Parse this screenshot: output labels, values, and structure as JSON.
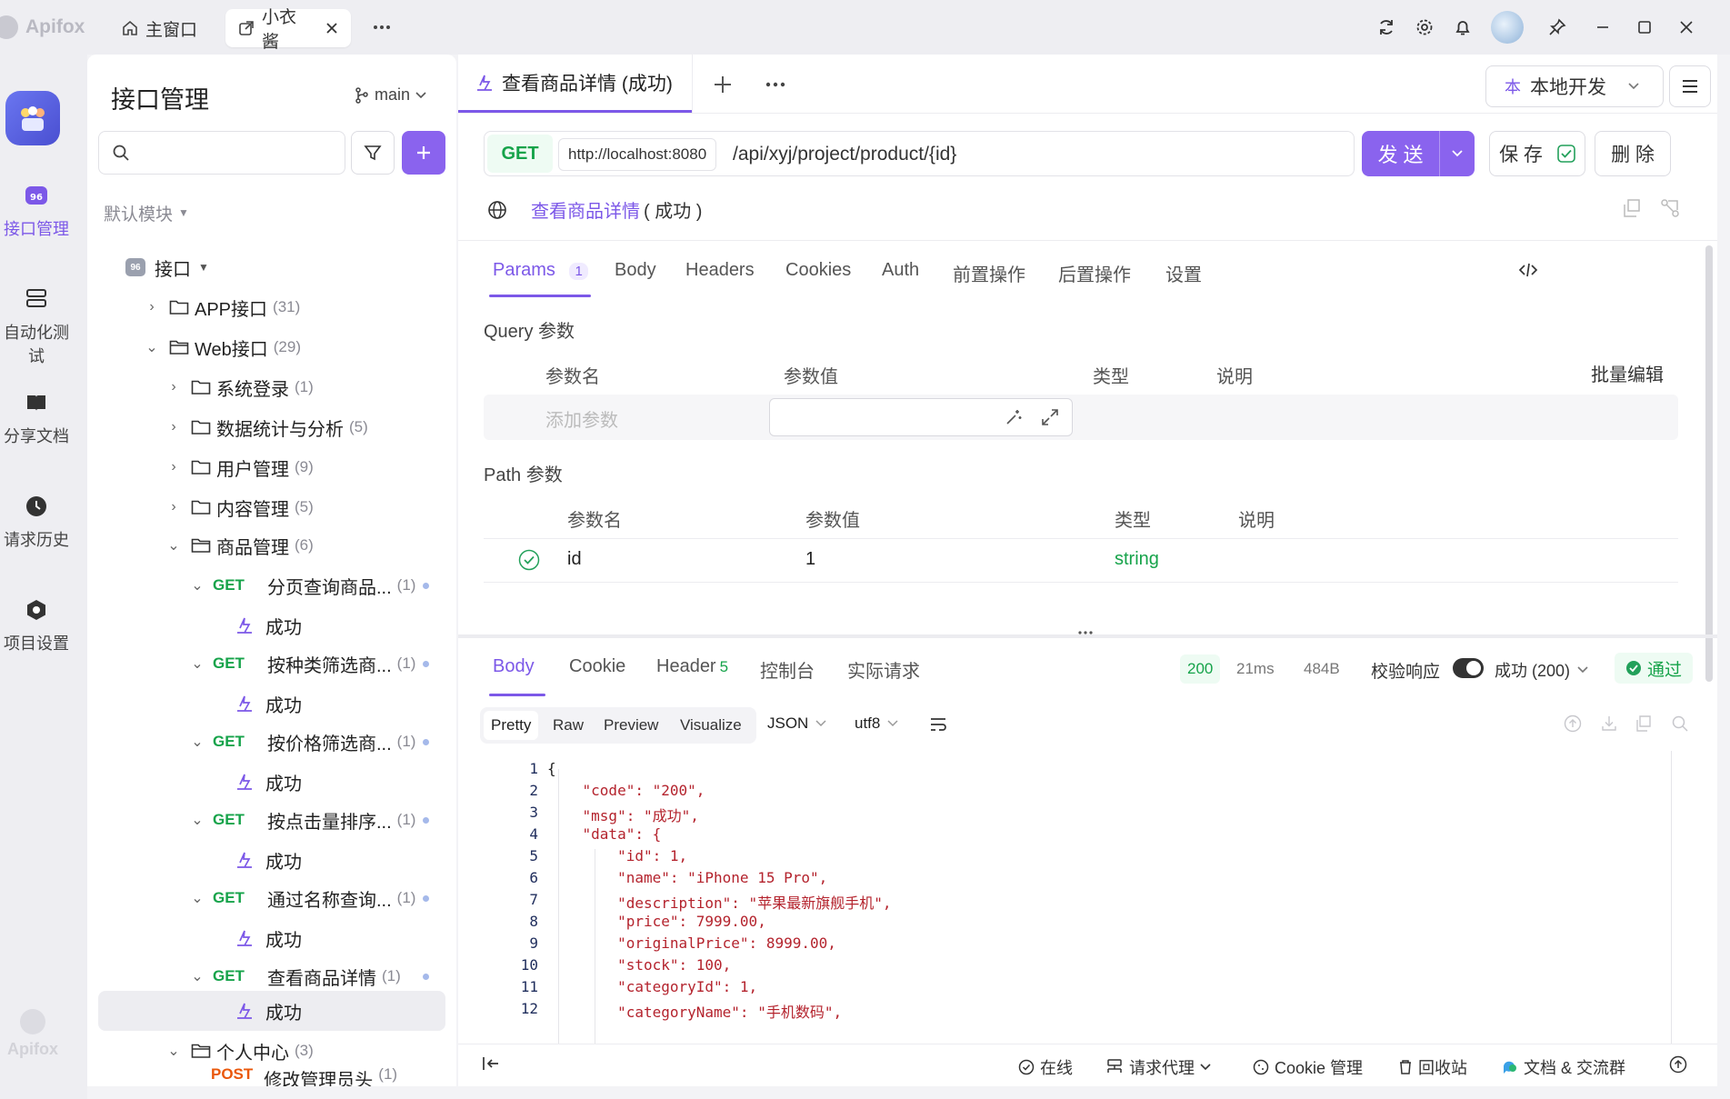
{
  "app": {
    "name": "Apifox",
    "tabs": [
      {
        "label": "主窗口"
      },
      {
        "label": "小衣酱"
      }
    ]
  },
  "rail": {
    "items": [
      {
        "label": "接口管理"
      },
      {
        "label": "自动化测试"
      },
      {
        "label": "分享文档"
      },
      {
        "label": "请求历史"
      },
      {
        "label": "项目设置"
      }
    ],
    "footer_logo": "Apifox"
  },
  "tree": {
    "title": "接口管理",
    "branch": "main",
    "search_placeholder": "",
    "module": "默认模块",
    "root": "接口",
    "folders": [
      {
        "name": "APP接口",
        "count": "(31)"
      },
      {
        "name": "Web接口",
        "count": "(29)"
      },
      {
        "name": "系统登录",
        "count": "(1)"
      },
      {
        "name": "数据统计与分析",
        "count": "(5)"
      },
      {
        "name": "用户管理",
        "count": "(9)"
      },
      {
        "name": "内容管理",
        "count": "(5)"
      },
      {
        "name": "商品管理",
        "count": "(6)"
      },
      {
        "name": "个人中心",
        "count": "(3)"
      }
    ],
    "endpoints": [
      {
        "method": "GET",
        "name": "分页查询商品...",
        "count": "(1)",
        "case": "成功"
      },
      {
        "method": "GET",
        "name": "按种类筛选商...",
        "count": "(1)",
        "case": "成功"
      },
      {
        "method": "GET",
        "name": "按价格筛选商...",
        "count": "(1)",
        "case": "成功"
      },
      {
        "method": "GET",
        "name": "按点击量排序...",
        "count": "(1)",
        "case": "成功"
      },
      {
        "method": "GET",
        "name": "通过名称查询...",
        "count": "(1)",
        "case": "成功"
      },
      {
        "method": "GET",
        "name": "查看商品详情",
        "count": "(1)",
        "case": "成功"
      }
    ],
    "partial_last": {
      "method": "POST",
      "name": "修改管理员头",
      "count": "(1)"
    }
  },
  "main": {
    "tab_title": "查看商品详情 (成功)",
    "env_badge": "本",
    "env_name": "本地开发",
    "request": {
      "method": "GET",
      "base_url": "http://localhost:8080",
      "path": "/api/xyj/project/product/{id}",
      "send": "发 送",
      "save": "保 存",
      "delete": "删 除"
    },
    "breadcrumb_name": "查看商品详情",
    "breadcrumb_case": "( 成功 )",
    "subtabs": [
      "Params",
      "Body",
      "Headers",
      "Cookies",
      "Auth",
      "前置操作",
      "后置操作",
      "设置"
    ],
    "params_count": "1",
    "query": {
      "title": "Query 参数",
      "cols": [
        "参数名",
        "参数值",
        "类型",
        "说明"
      ],
      "bulk_edit": "批量编辑",
      "add_placeholder": "添加参数"
    },
    "path_params": {
      "title": "Path 参数",
      "cols": [
        "参数名",
        "参数值",
        "类型",
        "说明"
      ],
      "rows": [
        {
          "name": "id",
          "value": "1",
          "type": "string"
        }
      ]
    },
    "response": {
      "tabs": [
        "Body",
        "Cookie",
        "Header",
        "控制台",
        "实际请求"
      ],
      "header_count": "5",
      "status": "200",
      "time": "21ms",
      "size": "484B",
      "validate_label": "校验响应",
      "validate_value": "成功 (200)",
      "pass": "通过",
      "views": [
        "Pretty",
        "Raw",
        "Preview",
        "Visualize"
      ],
      "format": "JSON",
      "encoding": "utf8",
      "code": [
        {
          "n": "1",
          "t": "{"
        },
        {
          "n": "2",
          "t": "    \"code\": \"200\","
        },
        {
          "n": "3",
          "t": "    \"msg\": \"成功\","
        },
        {
          "n": "4",
          "t": "    \"data\": {"
        },
        {
          "n": "5",
          "t": "        \"id\": 1,"
        },
        {
          "n": "6",
          "t": "        \"name\": \"iPhone 15 Pro\","
        },
        {
          "n": "7",
          "t": "        \"description\": \"苹果最新旗舰手机\","
        },
        {
          "n": "8",
          "t": "        \"price\": 7999.00,"
        },
        {
          "n": "9",
          "t": "        \"originalPrice\": 8999.00,"
        },
        {
          "n": "10",
          "t": "        \"stock\": 100,"
        },
        {
          "n": "11",
          "t": "        \"categoryId\": 1,"
        },
        {
          "n": "12",
          "t": "        \"categoryName\": \"手机数码\","
        }
      ]
    },
    "statusbar": {
      "online": "在线",
      "proxy": "请求代理",
      "cookie": "Cookie 管理",
      "recycle": "回收站",
      "docs": "文档 & 交流群"
    }
  }
}
